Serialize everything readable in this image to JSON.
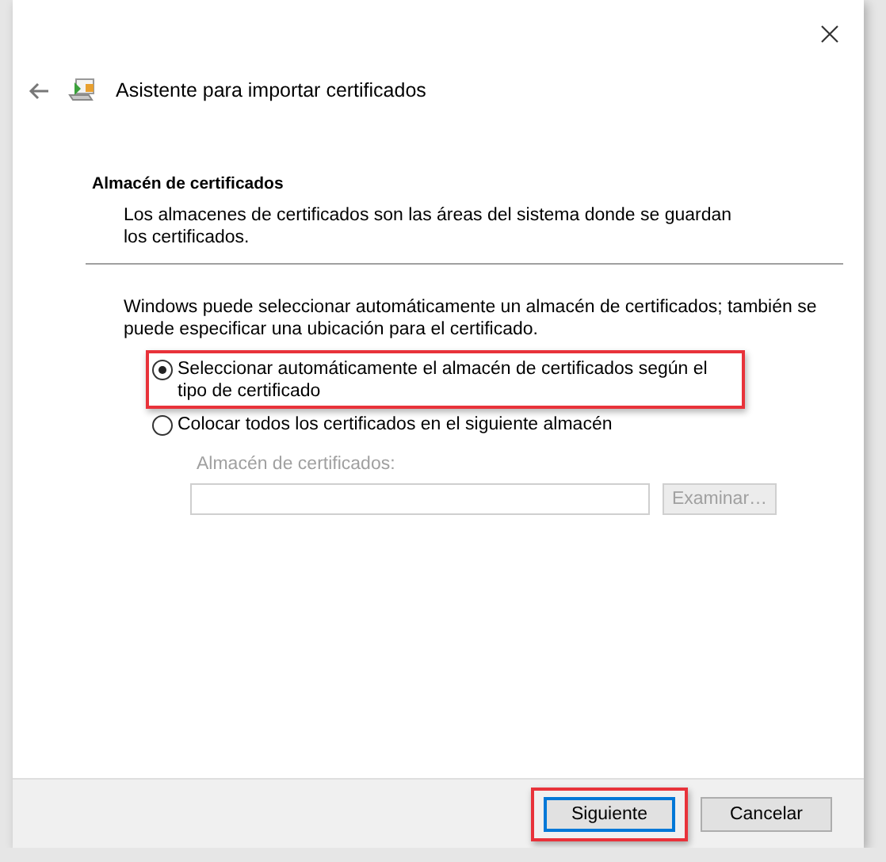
{
  "window": {
    "title": "Asistente para importar certificados"
  },
  "section": {
    "heading": "Almacén de certificados",
    "description": "Los almacenes de certificados son las áreas del sistema donde se guardan los certificados."
  },
  "intro": "Windows puede seleccionar automáticamente un almacén de certificados; también se puede especificar una ubicación para el certificado.",
  "options": [
    {
      "label": "Seleccionar automáticamente el almacén de certificados según el tipo de certificado",
      "selected": true,
      "highlighted": true
    },
    {
      "label": "Colocar todos los certificados en el siguiente almacén",
      "selected": false,
      "highlighted": false
    }
  ],
  "store_field": {
    "label": "Almacén de certificados:",
    "disabled": true
  },
  "browse_button": {
    "label": "Examinar…",
    "disabled": true
  },
  "buttons": [
    {
      "label": "Siguiente",
      "default": true,
      "highlighted": true
    },
    {
      "label": "Cancelar",
      "default": false,
      "highlighted": false
    }
  ]
}
